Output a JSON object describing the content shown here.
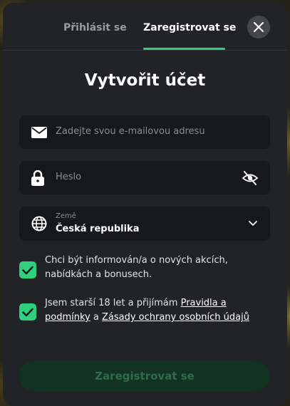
{
  "tabs": {
    "login": "Přihlásit se",
    "register": "Zaregistrovat se"
  },
  "title": "Vytvořit účet",
  "email": {
    "placeholder": "Zadejte svou e-mailovou adresu"
  },
  "password": {
    "placeholder": "Heslo"
  },
  "country": {
    "label": "Země",
    "value": "Česká republika"
  },
  "consents": {
    "marketing": {
      "text": "Chci být informován/a o nových akcích, nabídkách a bonusech.",
      "checked": true
    },
    "terms": {
      "text_1": "Jsem starší 18 let a přijímám ",
      "link_rules": "Pravidla a podmínky",
      "text_2": " a ",
      "link_privacy": "Zásady ochrany osobních údajů",
      "checked": true
    }
  },
  "submit_label": "Zaregistrovat se",
  "colors": {
    "accent": "#2fd07b",
    "modal_bg": "#222326",
    "field_bg": "#17181b",
    "submit_bg": "#123222"
  }
}
